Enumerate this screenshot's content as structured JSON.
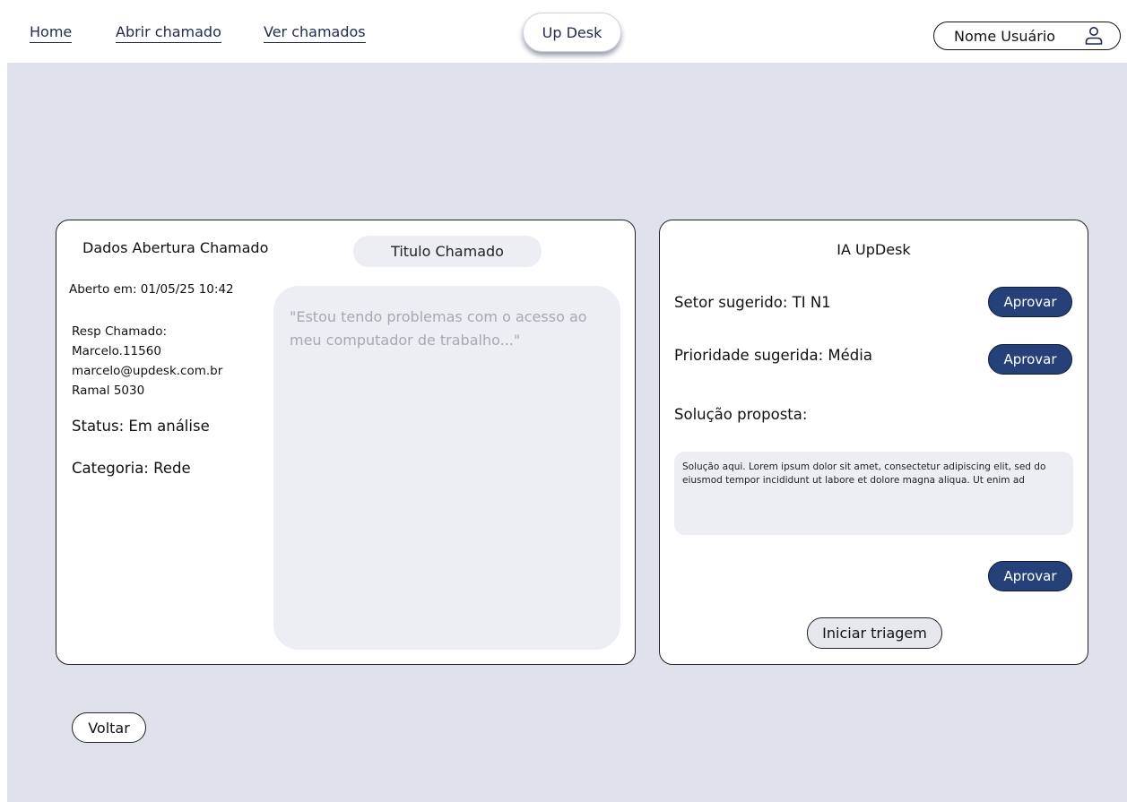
{
  "nav": {
    "home": "Home",
    "open_ticket": "Abrir chamado",
    "view_tickets": "Ver chamados",
    "brand": "Up Desk",
    "user_name": "Nome Usuário",
    "user_icon": "user-icon"
  },
  "ticket": {
    "section_title": "Dados Abertura Chamado",
    "title_placeholder": "Titulo Chamado",
    "opened_at": "Aberto em: 01/05/25 10:42",
    "resp_label": "Resp Chamado:",
    "resp_user": "Marcelo.11560",
    "resp_email": "marcelo@updesk.com.br",
    "resp_ext": "Ramal 5030",
    "status": "Status: Em análise",
    "category": "Categoria: Rede",
    "description": "\"Estou tendo problemas com o acesso ao meu computador de trabalho...\""
  },
  "ai": {
    "title": "IA UpDesk",
    "suggested_sector": "Setor sugerido: TI N1",
    "suggested_priority": "Prioridade sugerida: Média",
    "proposed_solution_label": "Solução proposta:",
    "proposed_solution_text": "Solução aqui. Lorem ipsum dolor sit amet, consectetur adipiscing elit, sed do eiusmod tempor incididunt ut labore et dolore magna aliqua. Ut enim ad",
    "approve_label": "Aprovar",
    "start_triage": "Iniciar triagem"
  },
  "footer": {
    "back": "Voltar"
  },
  "colors": {
    "background": "#dfe2ea",
    "primary_button": "#26407a",
    "panel_fill": "#eceef3"
  }
}
